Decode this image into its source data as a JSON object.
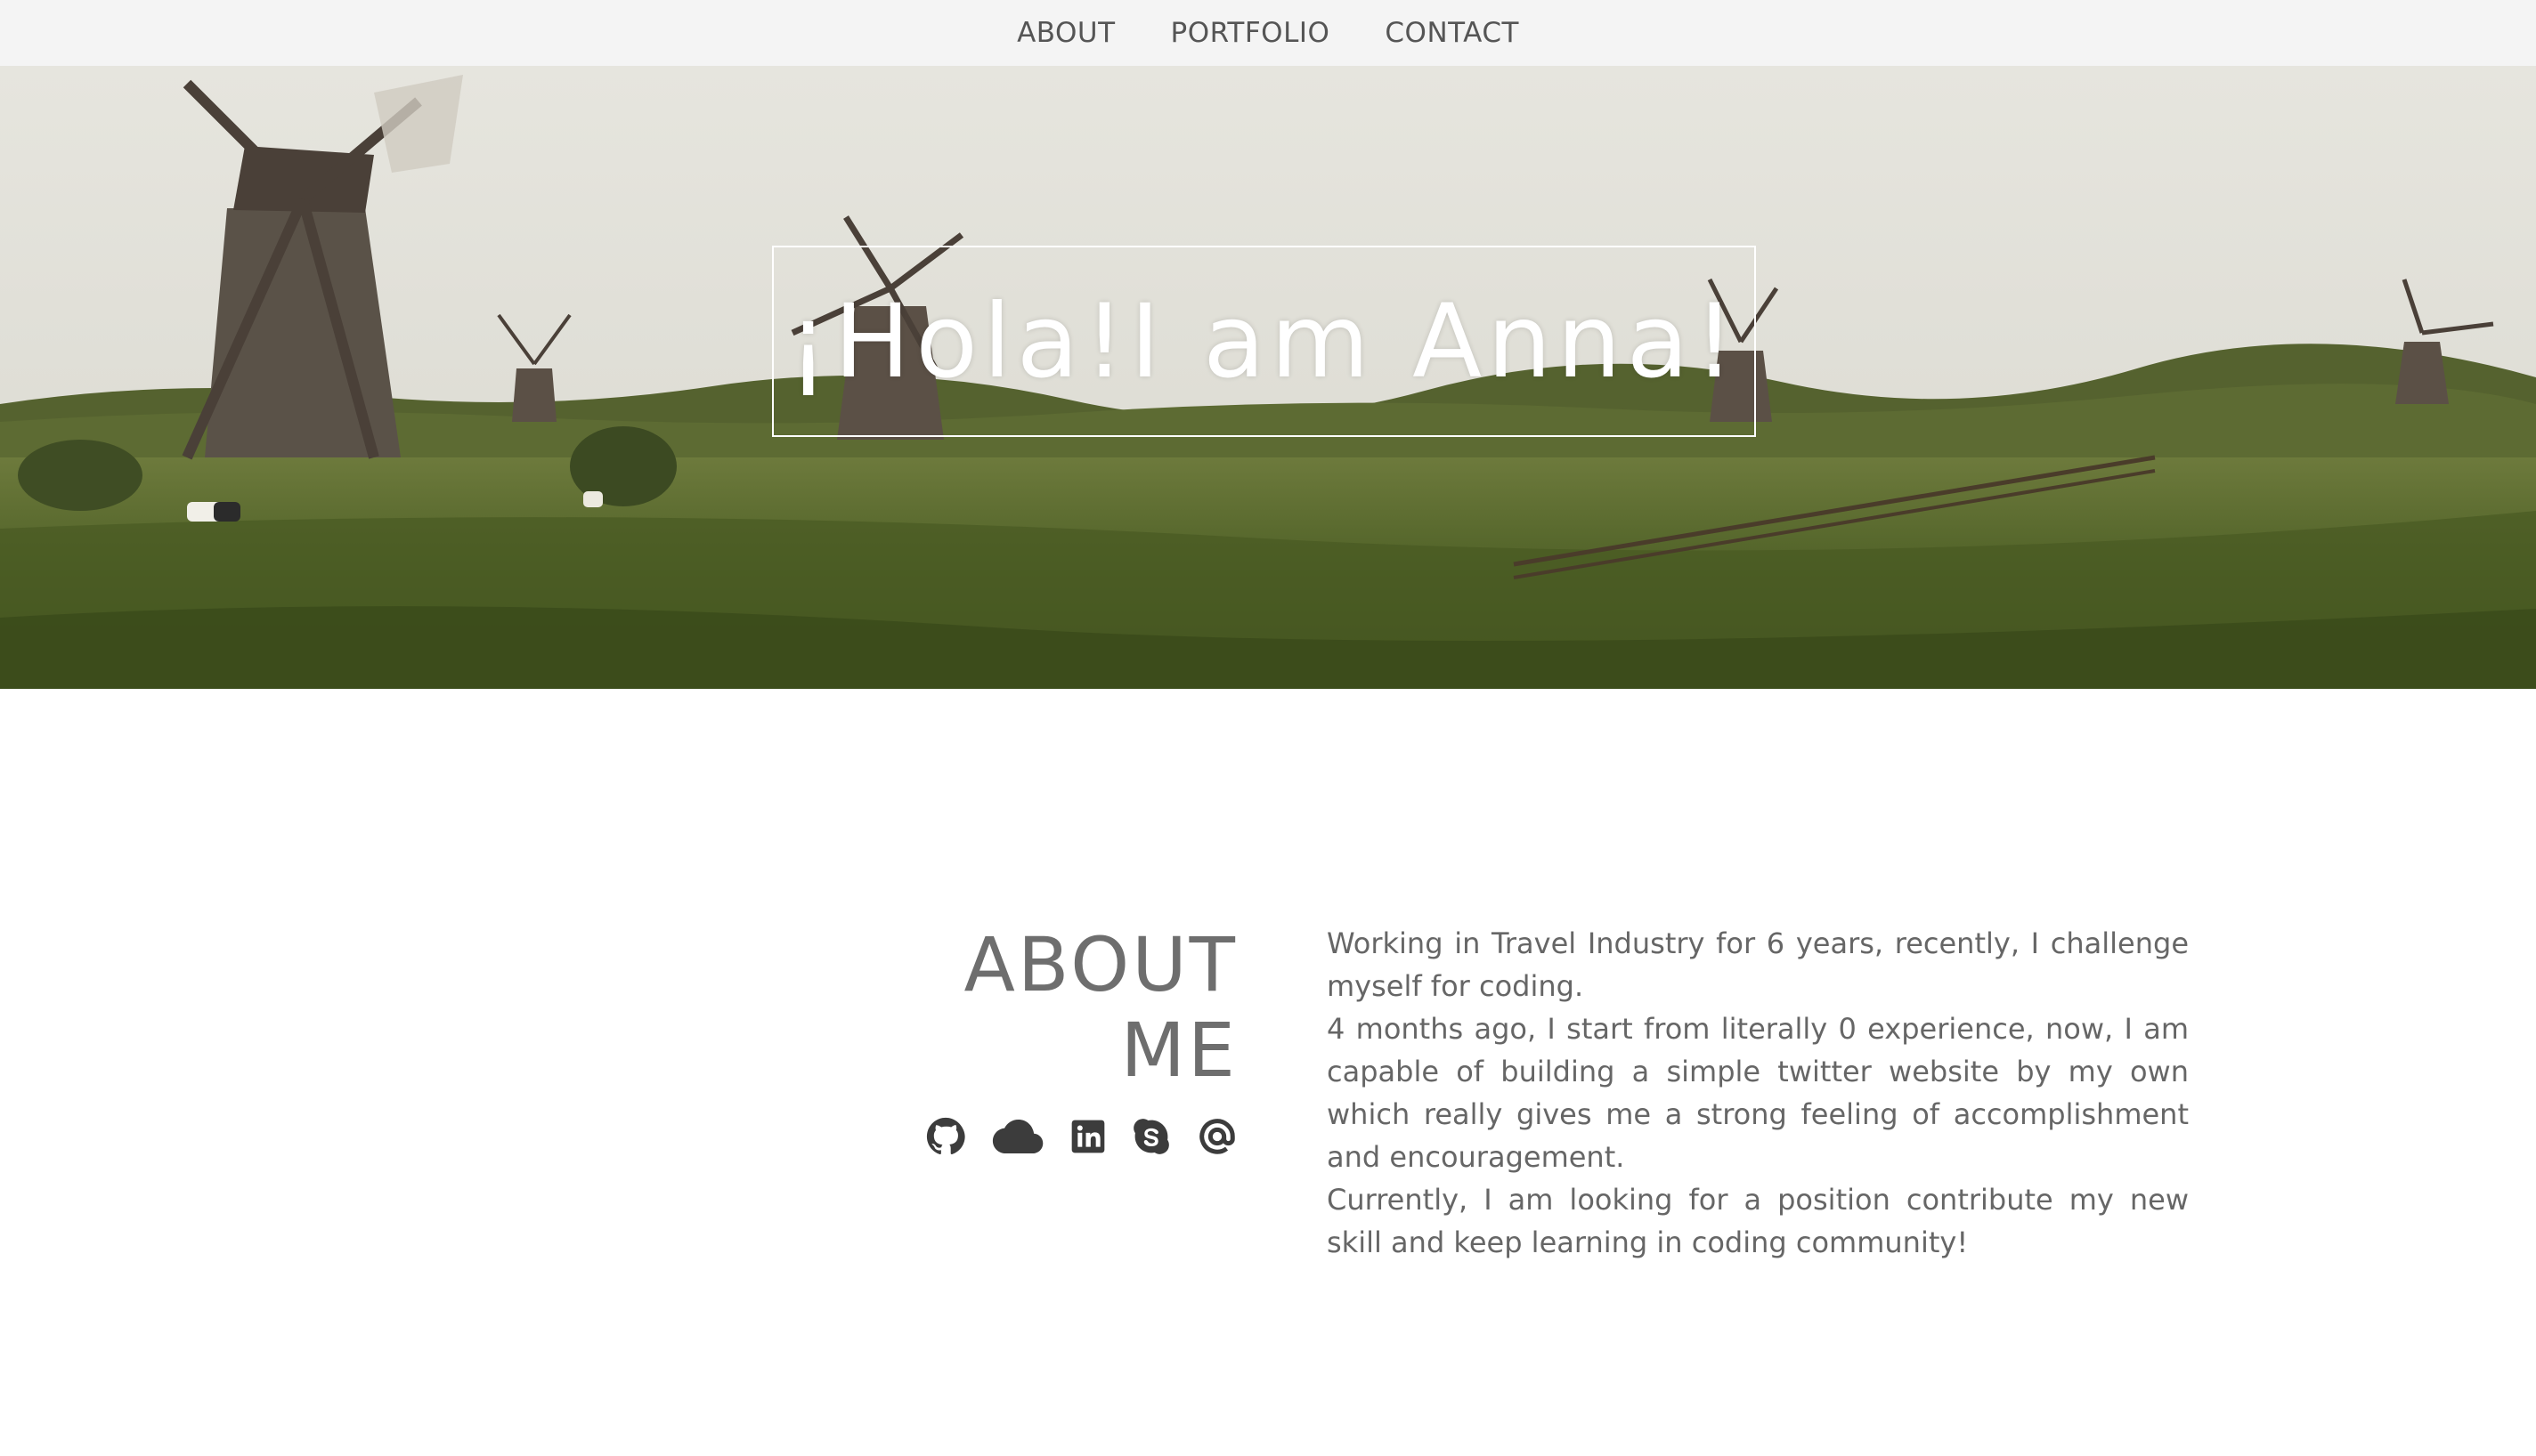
{
  "nav": {
    "items": [
      {
        "label": "ABOUT"
      },
      {
        "label": "PORTFOLIO"
      },
      {
        "label": "CONTACT"
      }
    ]
  },
  "hero": {
    "title": "¡Hola!I am Anna!",
    "background": "windmills-landscape-photo"
  },
  "about": {
    "heading_line1": "ABOUT",
    "heading_line2": "ME",
    "socials": [
      {
        "icon": "github-icon"
      },
      {
        "icon": "cloud-icon"
      },
      {
        "icon": "linkedin-icon"
      },
      {
        "icon": "skype-icon"
      },
      {
        "icon": "at-icon"
      }
    ],
    "paragraphs": [
      " Working in Travel Industry for 6 years, recently, I challenge myself for coding.",
      "  4 months ago, I start from literally 0 experience, now, I am capable of building a simple twitter website by my own which really gives me a strong feeling of accomplishment and encouragement.",
      " Currently, I am looking for a position contribute my new skill and keep learning in coding community!"
    ]
  },
  "colors": {
    "nav_bg": "#f4f4f4",
    "text": "#666666",
    "icon": "#3c3c3c"
  }
}
